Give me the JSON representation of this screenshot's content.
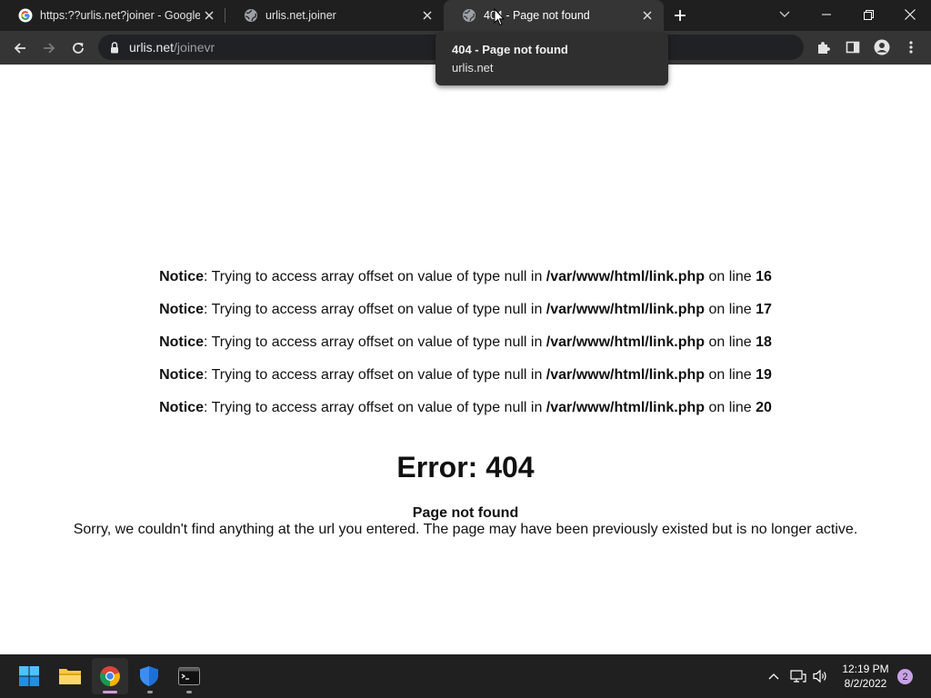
{
  "tabs": [
    {
      "title": "https:??urlis.net?joiner - Google S",
      "favicon": "google-g-icon"
    },
    {
      "title": "urlis.net.joiner",
      "favicon": "globe-icon"
    },
    {
      "title": "404 - Page not found",
      "favicon": "globe-icon",
      "active": true
    }
  ],
  "address_bar": {
    "host": "urlis.net",
    "path": "/joinevr"
  },
  "hover_card": {
    "title": "404 - Page not found",
    "domain": "urlis.net"
  },
  "notices": [
    {
      "label": "Notice",
      "message": ": Trying to access array offset on value of type null in ",
      "file": "/var/www/html/link.php",
      "online": " on line ",
      "line": "16"
    },
    {
      "label": "Notice",
      "message": ": Trying to access array offset on value of type null in ",
      "file": "/var/www/html/link.php",
      "online": " on line ",
      "line": "17"
    },
    {
      "label": "Notice",
      "message": ": Trying to access array offset on value of type null in ",
      "file": "/var/www/html/link.php",
      "online": " on line ",
      "line": "18"
    },
    {
      "label": "Notice",
      "message": ": Trying to access array offset on value of type null in ",
      "file": "/var/www/html/link.php",
      "online": " on line ",
      "line": "19"
    },
    {
      "label": "Notice",
      "message": ": Trying to access array offset on value of type null in ",
      "file": "/var/www/html/link.php",
      "online": " on line ",
      "line": "20"
    }
  ],
  "error": {
    "heading": "Error: 404",
    "title": "Page not found",
    "body": "Sorry, we couldn't find anything at the url you entered. The page may have been previously existed but is no longer active."
  },
  "taskbar": {
    "apps": [
      "windows-start-icon",
      "file-explorer-icon",
      "chrome-icon",
      "windows-defender-icon",
      "terminal-icon"
    ],
    "time": "12:19 PM",
    "date": "8/2/2022",
    "notification_count": "2"
  },
  "colors": {
    "tabstrip": "#1f1f1f",
    "toolbar": "#353535",
    "omnibox": "#202124",
    "taskbar": "#202020",
    "chrome_indicator": "#d39ad9"
  }
}
